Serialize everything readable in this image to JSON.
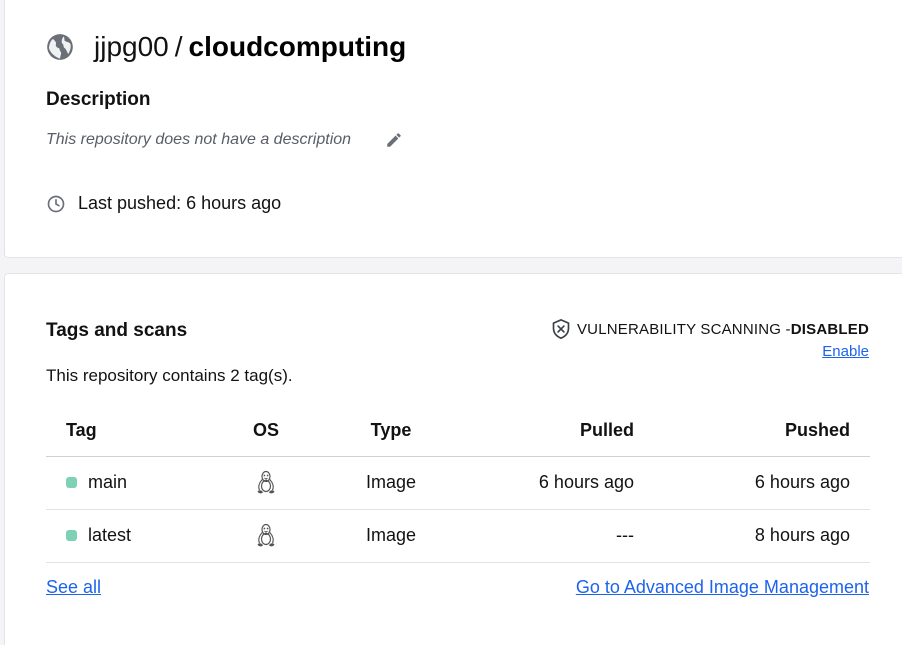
{
  "repo": {
    "owner": "jjpg00",
    "separator": "/",
    "name": "cloudcomputing",
    "icon": "globe-icon"
  },
  "description": {
    "heading": "Description",
    "text": "This repository does not have a description",
    "edit_icon": "pencil-icon"
  },
  "last_pushed": {
    "text": "Last pushed: 6 hours ago",
    "icon": "clock-icon"
  },
  "tags_section": {
    "heading": "Tags and scans",
    "vulnerability_label": "VULNERABILITY SCANNING - ",
    "vulnerability_status": "DISABLED",
    "vulnerability_icon": "shield-x-icon",
    "enable_link": "Enable",
    "count_text": "This repository contains 2 tag(s).",
    "columns": [
      "Tag",
      "OS",
      "Type",
      "Pulled",
      "Pushed"
    ],
    "rows": [
      {
        "tag": "main",
        "os": "linux-icon",
        "type": "Image",
        "pulled": "6 hours ago",
        "pushed": "6 hours ago"
      },
      {
        "tag": "latest",
        "os": "linux-icon",
        "type": "Image",
        "pulled": "---",
        "pushed": "8 hours ago"
      }
    ],
    "see_all": "See all",
    "advanced_link": "Go to Advanced Image Management"
  },
  "colors": {
    "link": "#1d63ed",
    "tag_dot": "#7dd1b4",
    "icon_gray": "#5f6368"
  }
}
